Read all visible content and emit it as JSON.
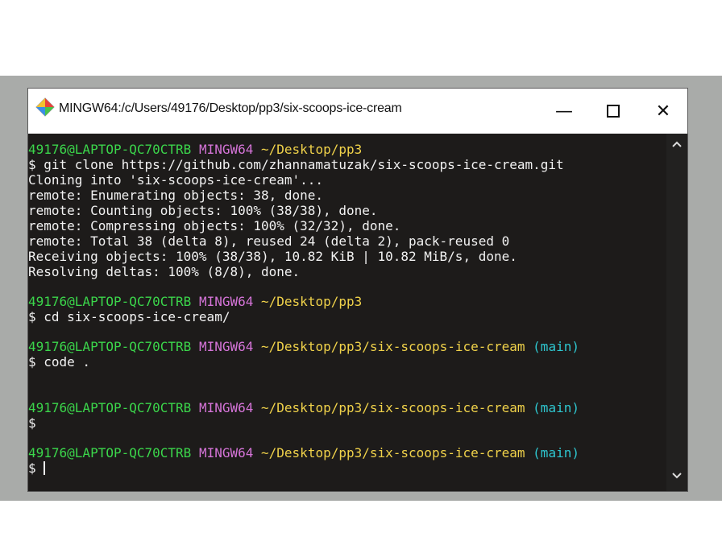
{
  "window": {
    "title": "MINGW64:/c/Users/49176/Desktop/pp3/six-scoops-ice-cream",
    "minimize_glyph": "—",
    "close_glyph": "✕"
  },
  "terminal": {
    "prompt1": {
      "user": "49176@LAPTOP-QC70CTRB",
      "shell": "MINGW64",
      "path": "~/Desktop/pp3"
    },
    "cmd1": "$ git clone https://github.com/zhannamatuzak/six-scoops-ice-cream.git",
    "output": [
      "Cloning into 'six-scoops-ice-cream'...",
      "remote: Enumerating objects: 38, done.",
      "remote: Counting objects: 100% (38/38), done.",
      "remote: Compressing objects: 100% (32/32), done.",
      "remote: Total 38 (delta 8), reused 24 (delta 2), pack-reused 0",
      "Receiving objects: 100% (38/38), 10.82 KiB | 10.82 MiB/s, done.",
      "Resolving deltas: 100% (8/8), done."
    ],
    "prompt2": {
      "user": "49176@LAPTOP-QC70CTRB",
      "shell": "MINGW64",
      "path": "~/Desktop/pp3"
    },
    "cmd2": "$ cd six-scoops-ice-cream/",
    "prompt3": {
      "user": "49176@LAPTOP-QC70CTRB",
      "shell": "MINGW64",
      "path": "~/Desktop/pp3/six-scoops-ice-cream",
      "branch": "(main)"
    },
    "cmd3": "$ code .",
    "prompt4": {
      "user": "49176@LAPTOP-QC70CTRB",
      "shell": "MINGW64",
      "path": "~/Desktop/pp3/six-scoops-ice-cream",
      "branch": "(main)"
    },
    "cmd4": "$",
    "prompt5": {
      "user": "49176@LAPTOP-QC70CTRB",
      "shell": "MINGW64",
      "path": "~/Desktop/pp3/six-scoops-ice-cream",
      "branch": "(main)"
    },
    "cmd5": "$ "
  },
  "colors": {
    "user": "#3bd64b",
    "shell": "#d574d8",
    "path": "#f0d24a",
    "branch": "#2ec7d0",
    "text": "#f2f2f2",
    "background": "#1d1b1a"
  },
  "icons": {
    "app": "mingw-diamond-icon",
    "scroll_up": "chevron-up-icon",
    "scroll_down": "chevron-down-icon"
  }
}
